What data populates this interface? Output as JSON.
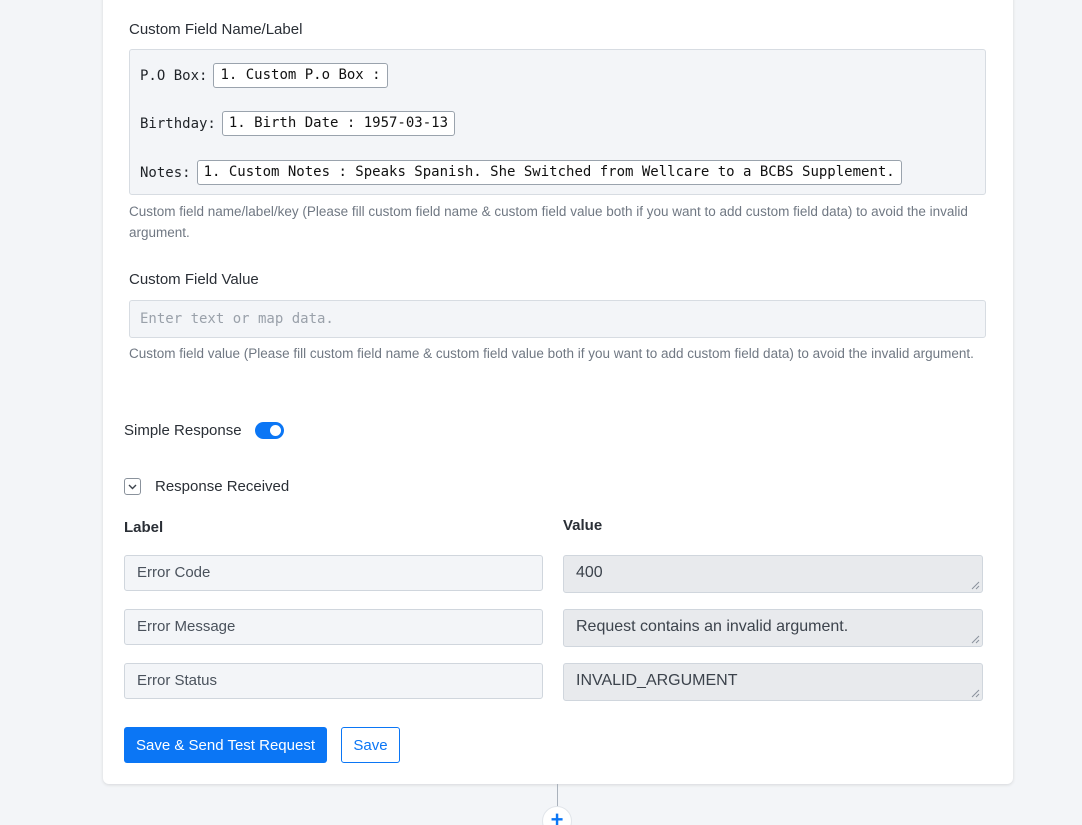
{
  "custom_field_name": {
    "title": "Custom Field Name/Label",
    "rows": [
      {
        "label": "P.O Box:",
        "chip": "1. Custom P.o Box :"
      },
      {
        "label": "Birthday:",
        "chip": "1. Birth Date : 1957-03-13"
      },
      {
        "label": "Notes:",
        "chip": "1. Custom Notes : Speaks Spanish. She Switched from Wellcare to a BCBS Supplement."
      }
    ],
    "help": "Custom field name/label/key (Please fill custom field name & custom field value both if you want to add custom field data) to avoid the invalid argument."
  },
  "custom_field_value": {
    "title": "Custom Field Value",
    "placeholder": "Enter text or map data.",
    "help": "Custom field value (Please fill custom field name & custom field value both if you want to add custom field data) to avoid the invalid argument."
  },
  "simple_response": {
    "label": "Simple Response",
    "enabled": true
  },
  "response_received": {
    "label": "Response Received",
    "col_label": "Label",
    "col_value": "Value",
    "rows": [
      {
        "label": "Error Code",
        "value": "400"
      },
      {
        "label": "Error Message",
        "value": "Request contains an invalid argument."
      },
      {
        "label": "Error Status",
        "value": "INVALID_ARGUMENT"
      }
    ]
  },
  "buttons": {
    "save_send": "Save & Send Test Request",
    "save": "Save",
    "add": "+"
  },
  "colors": {
    "accent": "#0b76f5",
    "background": "#f3f5f8"
  }
}
